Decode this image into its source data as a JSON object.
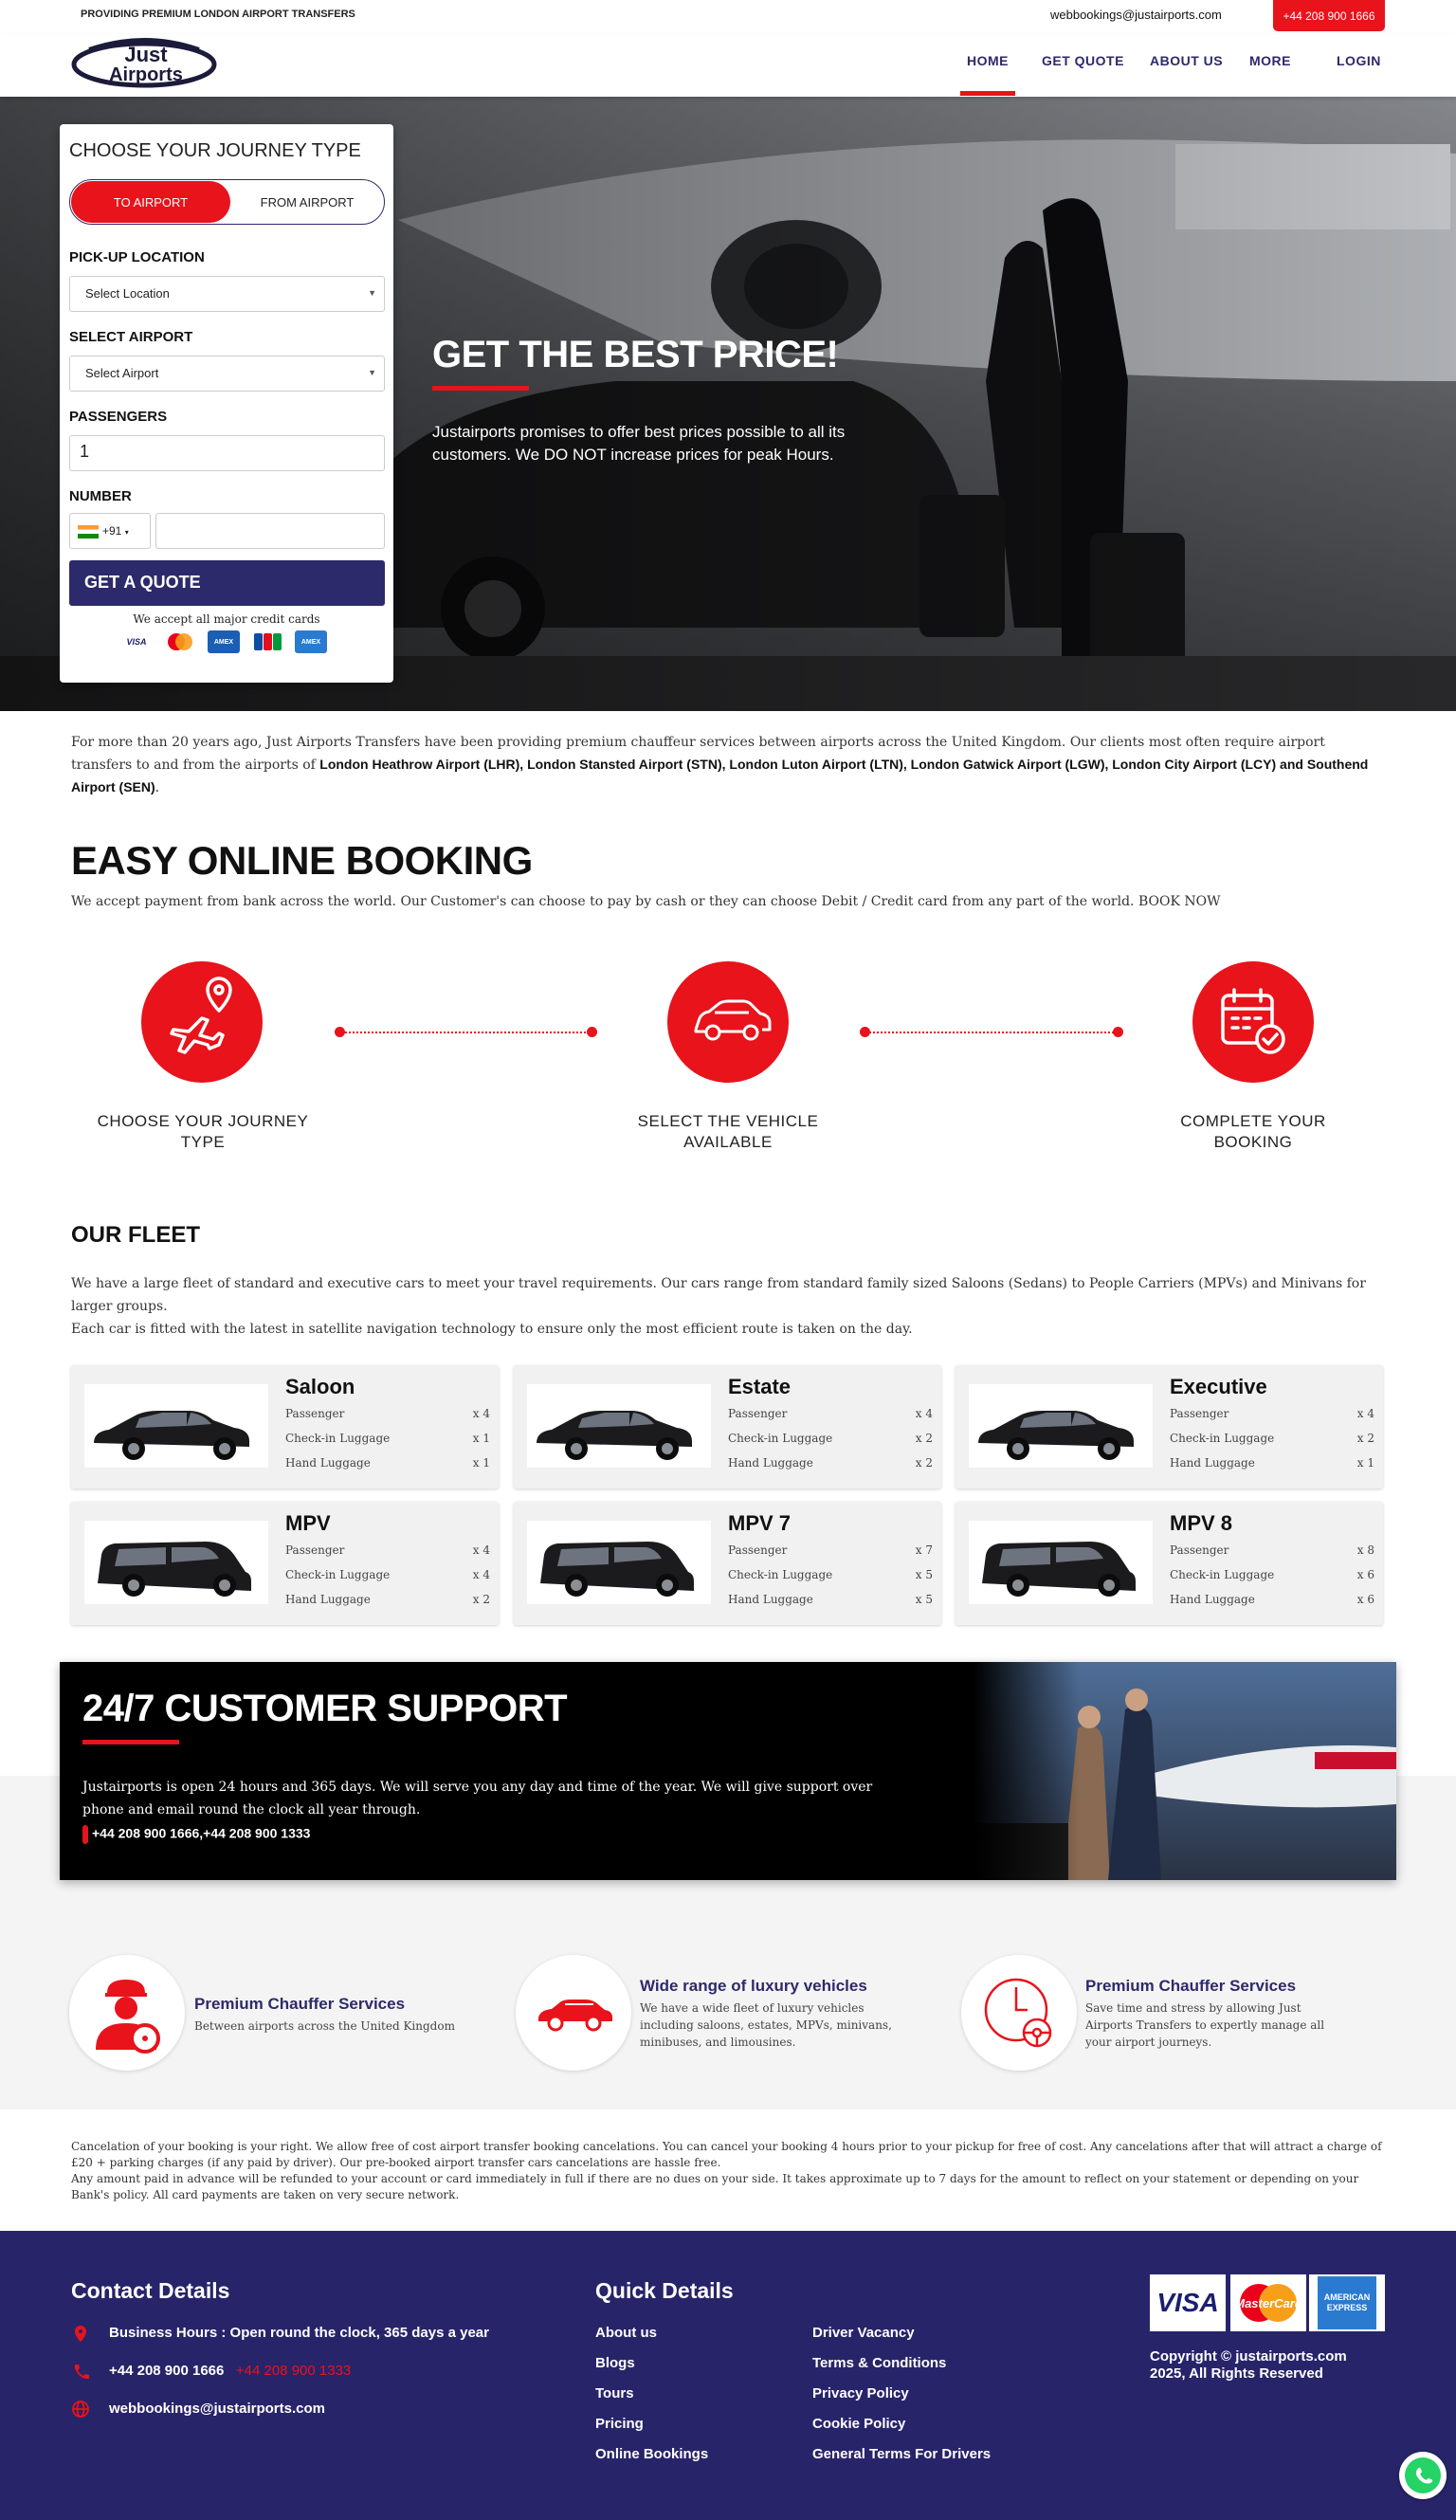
{
  "topbar": {
    "tagline": "PROVIDING PREMIUM LONDON AIRPORT TRANSFERS",
    "email": "webbookings@justairports.com",
    "phone_button": "+44 208 900 1666"
  },
  "logo": {
    "line1": "Just",
    "line2": "Airports"
  },
  "nav": {
    "items": [
      "HOME",
      "GET QUOTE",
      "ABOUT US",
      "MORE",
      "LOGIN"
    ],
    "active": "HOME"
  },
  "hero": {
    "title": "GET THE BEST PRICE!",
    "text": "Justairports promises to offer best prices possible to all its customers. We DO NOT increase prices for peak Hours."
  },
  "booking_form": {
    "heading": "CHOOSE YOUR JOURNEY TYPE",
    "toggle_to": "TO AIRPORT",
    "toggle_from": "FROM AIRPORT",
    "pickup_label": "PICK-UP LOCATION",
    "pickup_value": "Select Location",
    "airport_label": "SELECT AIRPORT",
    "airport_value": "Select Airport",
    "passengers_label": "PASSENGERS",
    "passengers_value": "1",
    "number_label": "NUMBER",
    "country_code": "+91",
    "quote_button": "GET A QUOTE",
    "cards_note": "We accept all major credit cards",
    "card_names": [
      "VISA",
      "MC",
      "AMEX",
      "JCB",
      "AMEX"
    ]
  },
  "intro": {
    "text_start": "For more than 20 years ago, Just Airports Transfers have been providing premium chauffeur services between airports across the United Kingdom. Our clients most often require airport transfers to and from the airports of ",
    "airports_bold": "London Heathrow Airport (LHR), London Stansted Airport (STN), London Luton Airport (LTN), London Gatwick Airport (LGW), London City Airport (LCY) and Southend Airport (SEN)",
    "text_end": "."
  },
  "easy_booking": {
    "title": "EASY ONLINE BOOKING",
    "subtitle": "We accept payment from bank across the world. Our Customer's can choose to pay by cash or they can choose Debit / Credit card from any part of the world. BOOK NOW",
    "steps": [
      {
        "label": "CHOOSE YOUR JOURNEY TYPE",
        "icon": "plane-location-icon"
      },
      {
        "label": "SELECT THE VEHICLE AVAILABLE",
        "icon": "car-icon"
      },
      {
        "label": "COMPLETE YOUR BOOKING",
        "icon": "calendar-check-icon"
      }
    ]
  },
  "fleet": {
    "title": "OUR FLEET",
    "text1": "We have a large fleet of standard and executive cars to meet your travel requirements. Our cars range from standard family sized Saloons (Sedans) to People Carriers (MPVs) and Minivans for larger groups.",
    "text2": "Each car is fitted with the latest in satellite navigation technology to ensure only the most efficient route is taken on the day.",
    "row_labels": [
      "Passenger",
      "Check-in Luggage",
      "Hand Luggage"
    ],
    "cars": [
      {
        "name": "Saloon",
        "values": [
          "x 4",
          "x 1",
          "x 1"
        ]
      },
      {
        "name": "Estate",
        "values": [
          "x 4",
          "x 2",
          "x 2"
        ]
      },
      {
        "name": "Executive",
        "values": [
          "x 4",
          "x 2",
          "x 1"
        ]
      },
      {
        "name": "MPV",
        "values": [
          "x 4",
          "x 4",
          "x 2"
        ]
      },
      {
        "name": "MPV 7",
        "values": [
          "x 7",
          "x 5",
          "x 5"
        ]
      },
      {
        "name": "MPV 8",
        "values": [
          "x 8",
          "x 6",
          "x 6"
        ]
      }
    ]
  },
  "support": {
    "title": "24/7 CUSTOMER SUPPORT",
    "text": "Justairports is open 24 hours and 365 days. We will serve you any day and time of the year. We will give support over phone and email round the clock all year through.",
    "phones": "+44 208 900 1666,+44 208 900 1333"
  },
  "features": [
    {
      "title": "Premium Chauffer Services",
      "text": "Between airports across the United Kingdom",
      "icon": "chauffeur-icon"
    },
    {
      "title": "Wide range of luxury vehicles",
      "text": "We have a wide fleet of luxury vehicles including saloons, estates, MPVs, minivans, minibuses, and limousines.",
      "icon": "red-car-icon"
    },
    {
      "title": "Premium Chauffer Services",
      "text": "Save time and stress by allowing Just Airports Transfers to expertly manage all your airport journeys.",
      "icon": "clock-wheel-icon"
    }
  ],
  "cancellation": {
    "p1": "Cancelation of your booking is your right. We allow free of cost airport transfer booking cancelations. You can cancel your booking 4 hours prior to your pickup for free of cost. Any cancelations after that will attract a charge of £20 + parking charges (if any paid by driver). Our pre-booked airport transfer cars cancelations are hassle free.",
    "p2": "Any amount paid in advance will be refunded to your account or card immediately in full if there are no dues on your side. It takes approximate up to 7 days for the amount to reflect on your statement or depending on your Bank's policy. All card payments are taken on very secure network."
  },
  "footer": {
    "contact_title": "Contact Details",
    "hours": "Business Hours : Open round the clock, 365 days a year",
    "phone1": "+44 208 900 1666",
    "phone2": "+44 208 900 1333",
    "email": "webbookings@justairports.com",
    "quick_title": "Quick Details",
    "links_col1": [
      "About us",
      "Blogs",
      "Tours",
      "Pricing",
      "Online Bookings"
    ],
    "links_col2": [
      "Driver Vacancy",
      "Terms & Conditions",
      "Privacy Policy",
      "Cookie Policy",
      "General Terms For Drivers"
    ],
    "payment_cards": [
      "VISA",
      "MasterCard",
      "AMERICAN EXPRESS"
    ],
    "copyright_line1": "Copyright © justairports.com",
    "copyright_line2": "2025, All Rights Reserved"
  },
  "colors": {
    "accent": "#e8131b",
    "navy": "#2d2a6b",
    "footer": "#28246a"
  }
}
